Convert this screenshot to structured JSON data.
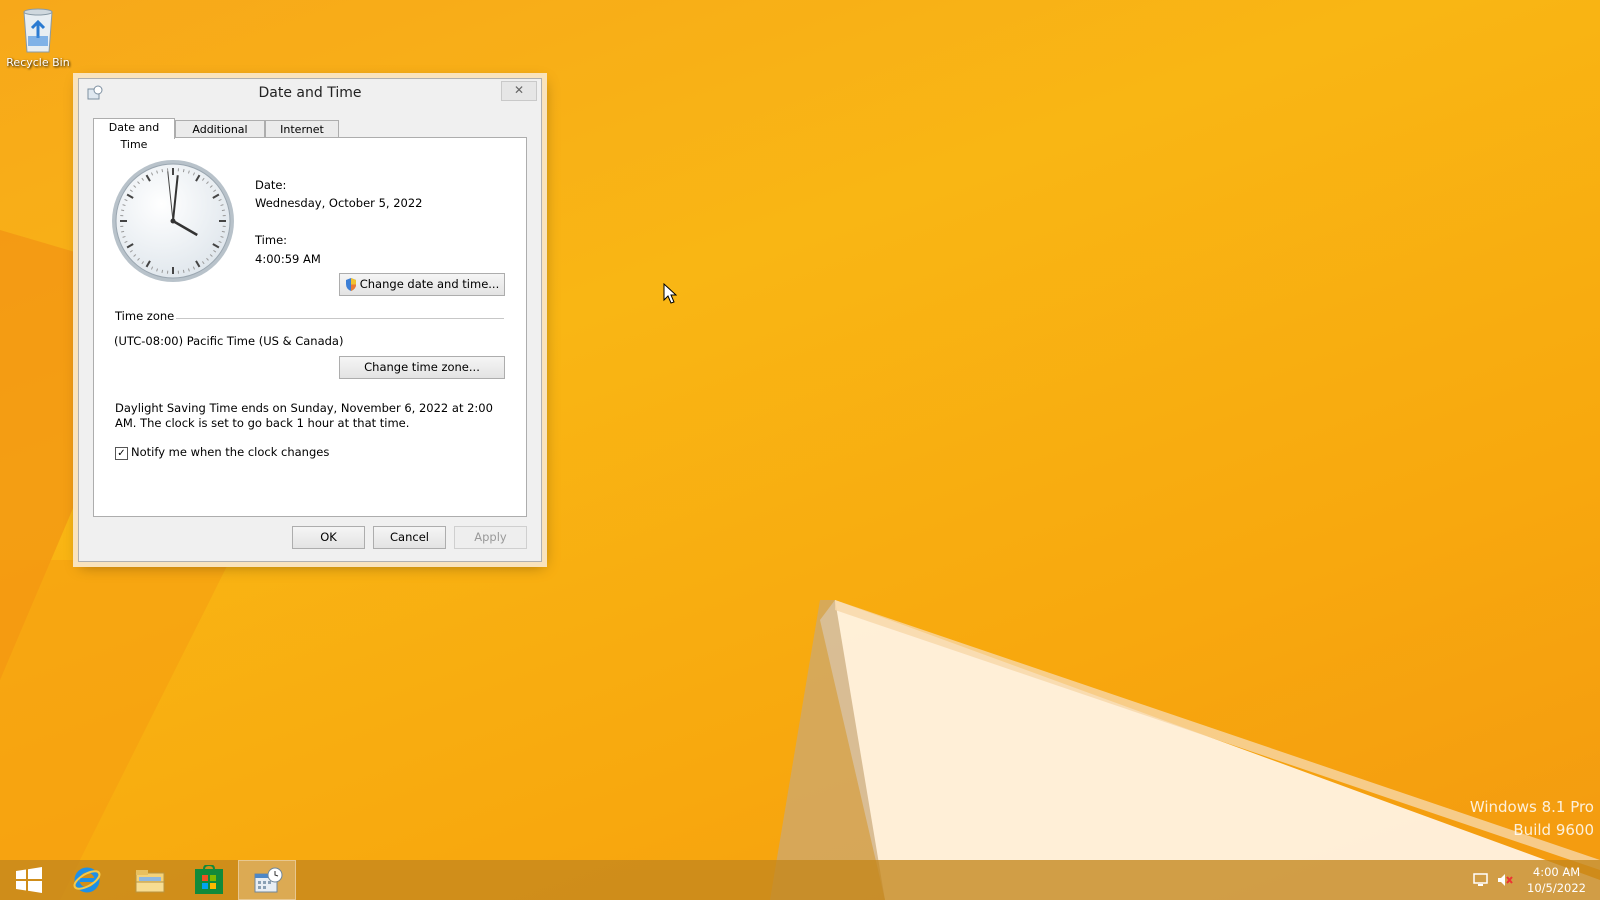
{
  "desktop": {
    "recycle_bin_label": "Recycle Bin",
    "watermark_line1": "Windows 8.1 Pro",
    "watermark_line2": "Build 9600"
  },
  "dialog": {
    "title": "Date and Time",
    "close_glyph": "✕",
    "tabs": [
      {
        "label": "Date and Time",
        "active": true
      },
      {
        "label": "Additional Clocks",
        "active": false
      },
      {
        "label": "Internet Time",
        "active": false
      }
    ],
    "date_label": "Date:",
    "date_value": "Wednesday, October 5, 2022",
    "time_label": "Time:",
    "time_value": "4:00:59 AM",
    "change_date_button": "Change date and time...",
    "time_zone_heading": "Time zone",
    "time_zone_value": "(UTC-08:00) Pacific Time (US & Canada)",
    "change_zone_button": "Change time zone...",
    "dst_text": "Daylight Saving Time ends on Sunday, November 6, 2022 at 2:00 AM. The clock is set to go back 1 hour at that time.",
    "notify_checkbox_label": "Notify me when the clock changes",
    "notify_checked": true,
    "ok_button": "OK",
    "cancel_button": "Cancel",
    "apply_button": "Apply",
    "clock_hour": 4,
    "clock_minute": 0,
    "clock_second": 59
  },
  "taskbar": {
    "items": [
      "start-icon",
      "internet-explorer-icon",
      "file-explorer-icon",
      "store-icon",
      "date-time-icon"
    ],
    "tray_time": "4:00 AM",
    "tray_date": "10/5/2022"
  }
}
